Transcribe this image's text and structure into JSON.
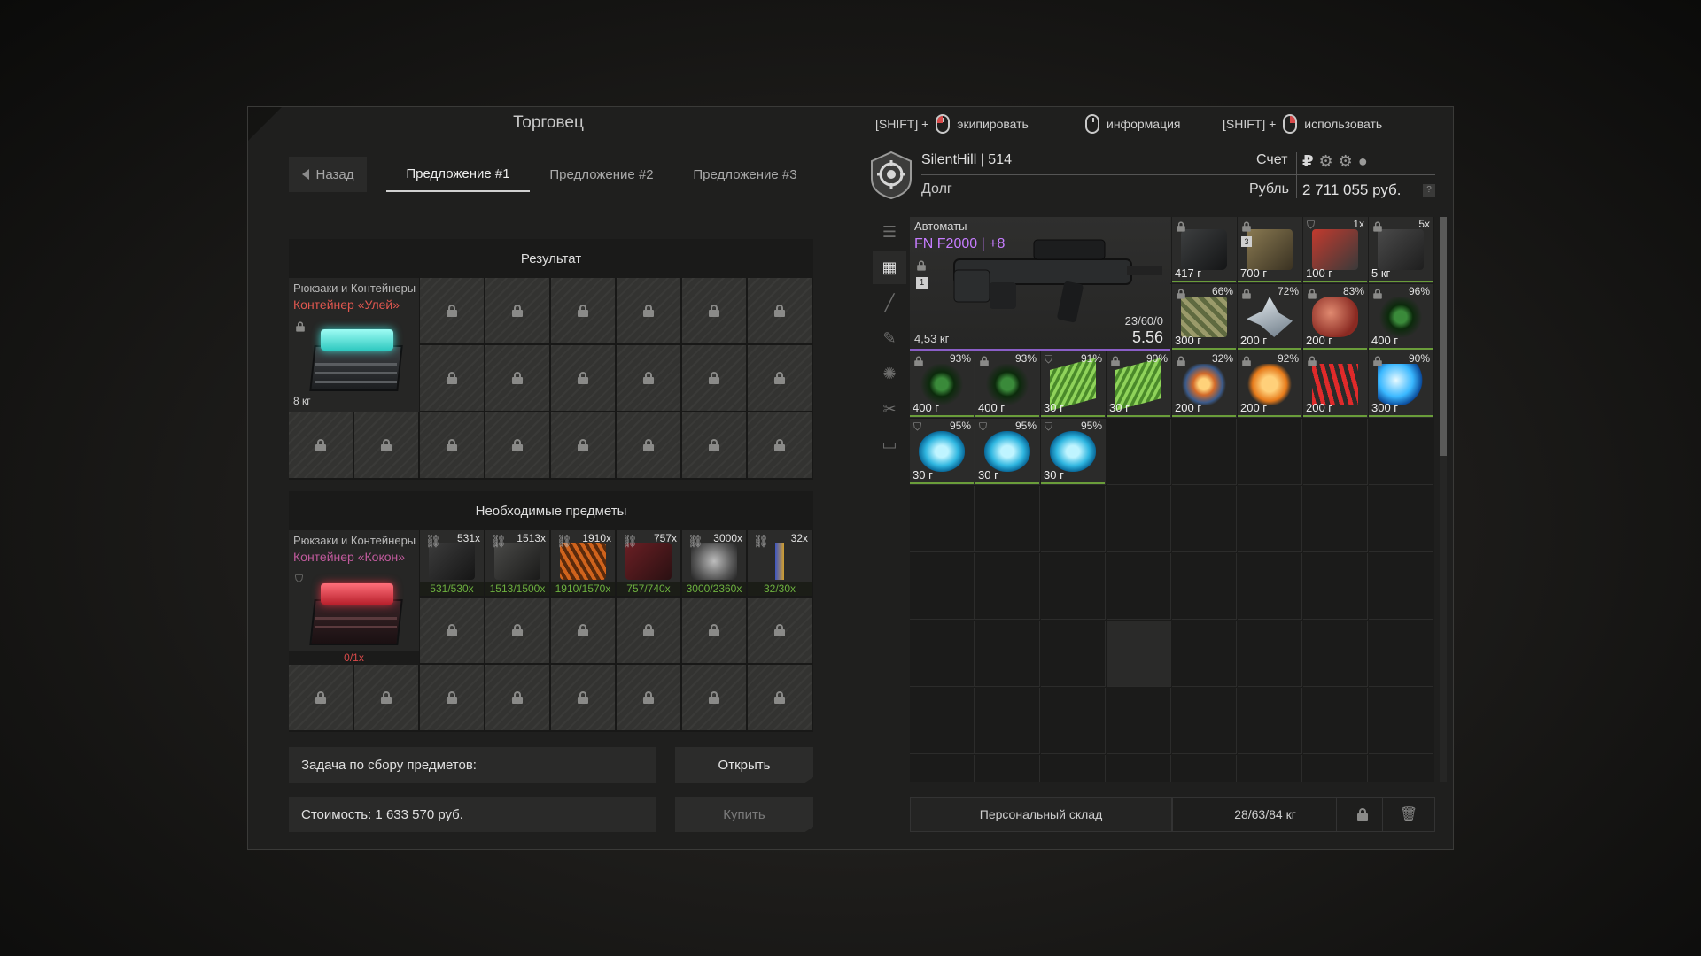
{
  "trader": {
    "title": "Торговец",
    "back_label": "Назад",
    "tabs": [
      "Предложение #1",
      "Предложение #2",
      "Предложение #3"
    ],
    "result_header": "Результат",
    "required_header": "Необходимые предметы",
    "result_item": {
      "category": "Рюкзаки и Контейнеры",
      "name": "Контейнер «Улей»",
      "name_color": "#e0574f",
      "weight": "8 кг"
    },
    "required_item": {
      "category": "Рюкзаки и Контейнеры",
      "name": "Контейнер «Кокон»",
      "name_color": "#c05a9c",
      "progress": "0/1x"
    },
    "required_materials": [
      {
        "count": "531x",
        "progress": "531/530x"
      },
      {
        "count": "1513x",
        "progress": "1513/1500x"
      },
      {
        "count": "1910x",
        "progress": "1910/1570x"
      },
      {
        "count": "757x",
        "progress": "757/740x"
      },
      {
        "count": "3000x",
        "progress": "3000/2360x"
      },
      {
        "count": "32x",
        "progress": "32/30x"
      }
    ],
    "task_label": "Задача по сбору предметов:",
    "open_button": "Открыть",
    "cost_label": "Стоимость: 1 633 570 руб.",
    "buy_button": "Купить"
  },
  "hints": {
    "equip_prefix": "[SHIFT] +",
    "equip": "экипировать",
    "info": "информация",
    "use_prefix": "[SHIFT] +",
    "use": "использовать"
  },
  "player": {
    "name": "SilentHill | 514",
    "debt_label": "Долг",
    "account_label": "Счет",
    "currency_label": "Рубль",
    "balance": "2 711 055 руб.",
    "currency_symbol": "₽",
    "help": "?"
  },
  "inventory": {
    "weapon": {
      "category": "Автоматы",
      "name": "FN F2000 | +8",
      "weight": "4,53 кг",
      "ammo": "23/60/0",
      "caliber": "5.56",
      "level": "1"
    },
    "items": [
      {
        "price": "417 г",
        "pct": "",
        "locked": true,
        "icon": "scope-icon"
      },
      {
        "price": "700 г",
        "pct": "",
        "locked": true,
        "icon": "binoculars-icon",
        "badge": "3"
      },
      {
        "price": "100 г",
        "pct": "1x",
        "locked": false,
        "icon": "detector-icon"
      },
      {
        "price": "5 кг",
        "pct": "5x",
        "locked": true,
        "icon": "device-icon"
      },
      {
        "price": "300 г",
        "pct": "66%",
        "locked": true,
        "icon": "map-artifact-icon"
      },
      {
        "price": "200 г",
        "pct": "72%",
        "locked": true,
        "icon": "crystal-artifact-icon"
      },
      {
        "price": "200 г",
        "pct": "83%",
        "locked": true,
        "icon": "flesh-artifact-icon"
      },
      {
        "price": "400 г",
        "pct": "96%",
        "locked": true,
        "icon": "urchin-artifact-icon"
      },
      {
        "price": "400 г",
        "pct": "93%",
        "locked": true,
        "icon": "urchin-artifact-icon"
      },
      {
        "price": "400 г",
        "pct": "93%",
        "locked": true,
        "icon": "urchin-artifact-icon"
      },
      {
        "price": "30 г",
        "pct": "91%",
        "locked": false,
        "icon": "moss-artifact-icon"
      },
      {
        "price": "30 г",
        "pct": "90%",
        "locked": true,
        "icon": "moss-artifact-icon"
      },
      {
        "price": "200 г",
        "pct": "32%",
        "locked": true,
        "icon": "burst-artifact-icon"
      },
      {
        "price": "200 г",
        "pct": "92%",
        "locked": true,
        "icon": "sun-artifact-icon"
      },
      {
        "price": "200 г",
        "pct": "",
        "locked": true,
        "icon": "coral-artifact-icon"
      },
      {
        "price": "300 г",
        "pct": "90%",
        "locked": true,
        "icon": "orb-artifact-icon"
      },
      {
        "price": "30 г",
        "pct": "95%",
        "locked": false,
        "icon": "ice-artifact-icon"
      },
      {
        "price": "30 г",
        "pct": "95%",
        "locked": false,
        "icon": "ice-artifact-icon"
      },
      {
        "price": "30 г",
        "pct": "95%",
        "locked": false,
        "icon": "ice-artifact-icon"
      }
    ],
    "stash_label": "Персональный склад",
    "weight": "28/63/84 кг"
  }
}
